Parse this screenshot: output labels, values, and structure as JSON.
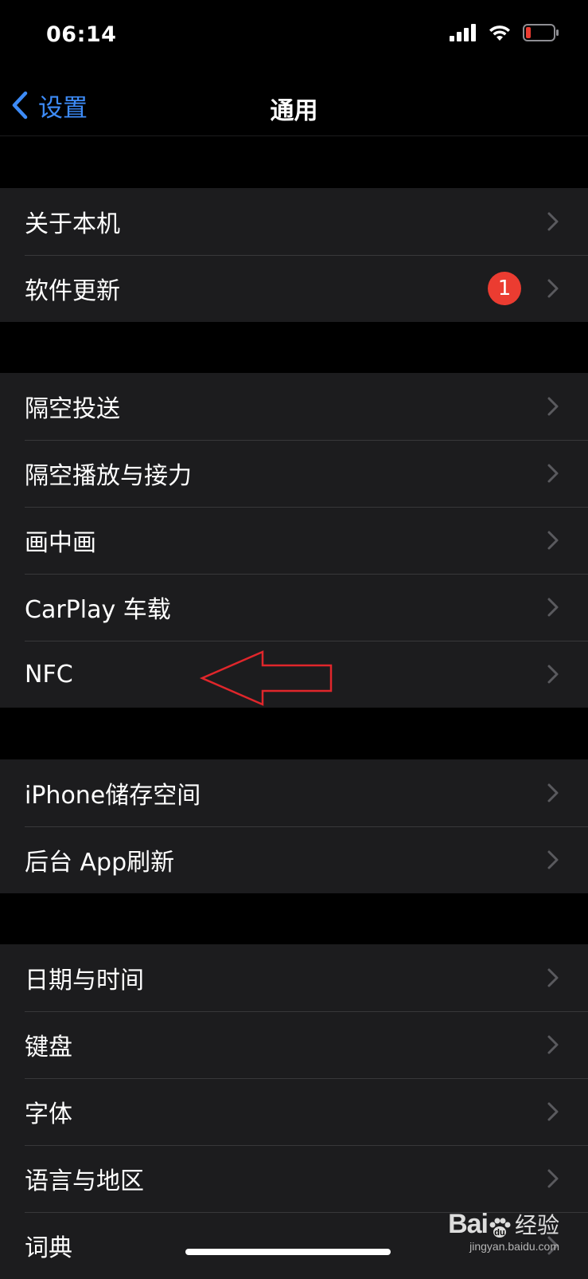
{
  "status_bar": {
    "time": "06:14",
    "icons": [
      "cellular-signal-icon",
      "wifi-icon",
      "battery-low-icon"
    ]
  },
  "nav": {
    "back_label": "设置",
    "title": "通用"
  },
  "colors": {
    "accent_blue": "#3d8bf7",
    "badge_red": "#eb3c31",
    "annotation_red": "#e0262b",
    "cell_background": "#1c1c1e",
    "page_background": "#000000"
  },
  "groups": [
    {
      "items": [
        {
          "label": "关于本机"
        },
        {
          "label": "软件更新",
          "badge": "1"
        }
      ]
    },
    {
      "items": [
        {
          "label": "隔空投送"
        },
        {
          "label": "隔空播放与接力"
        },
        {
          "label": "画中画"
        },
        {
          "label": "CarPlay 车载"
        },
        {
          "label": "NFC"
        }
      ]
    },
    {
      "items": [
        {
          "label": "iPhone储存空间"
        },
        {
          "label": "后台 App刷新"
        }
      ]
    },
    {
      "items": [
        {
          "label": "日期与时间"
        },
        {
          "label": "键盘"
        },
        {
          "label": "字体"
        },
        {
          "label": "语言与地区"
        },
        {
          "label": "词典"
        }
      ]
    }
  ],
  "annotation": {
    "type": "red-outline-arrow",
    "points_to": "NFC"
  },
  "watermark": {
    "logo": "Bai",
    "text": "经验",
    "sub": "jingyan.baidu.com"
  }
}
